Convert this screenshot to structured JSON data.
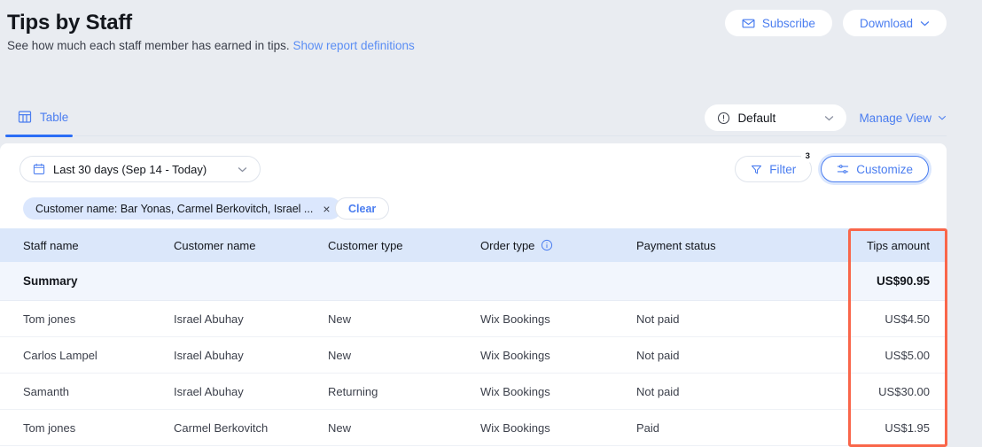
{
  "header": {
    "title": "Tips by Staff",
    "subtitle_text": "See how much each staff member has earned in tips.",
    "subtitle_link": "Show report definitions",
    "subscribe_label": "Subscribe",
    "download_label": "Download"
  },
  "tabs": {
    "items": [
      {
        "label": "Table",
        "icon": "table-icon",
        "active": true
      }
    ],
    "view_select_value": "Default",
    "manage_view_label": "Manage View"
  },
  "filterbar": {
    "date_range": "Last 30 days (Sep 14 - Today)",
    "filter_label": "Filter",
    "filter_count": "3",
    "customize_label": "Customize",
    "chip_label": "Customer name: Bar Yonas, Carmel Berkovitch, Israel ...",
    "chip_close": "×",
    "clear_label": "Clear"
  },
  "table": {
    "columns": [
      "Staff name",
      "Customer name",
      "Customer type",
      "Order type",
      "Payment status",
      "Tips amount"
    ],
    "order_type_has_info_icon": true,
    "summary": {
      "label": "Summary",
      "tips_amount": "US$90.95"
    },
    "rows": [
      {
        "staff_name": "Tom jones",
        "customer_name": "Israel Abuhay",
        "customer_type": "New",
        "order_type": "Wix Bookings",
        "payment_status": "Not paid",
        "tips_amount": "US$4.50"
      },
      {
        "staff_name": "Carlos Lampel",
        "customer_name": "Israel Abuhay",
        "customer_type": "New",
        "order_type": "Wix Bookings",
        "payment_status": "Not paid",
        "tips_amount": "US$5.00"
      },
      {
        "staff_name": "Samanth",
        "customer_name": "Israel Abuhay",
        "customer_type": "Returning",
        "order_type": "Wix Bookings",
        "payment_status": "Not paid",
        "tips_amount": "US$30.00"
      },
      {
        "staff_name": "Tom jones",
        "customer_name": "Carmel Berkovitch",
        "customer_type": "New",
        "order_type": "Wix Bookings",
        "payment_status": "Paid",
        "tips_amount": "US$1.95"
      }
    ]
  },
  "colors": {
    "page_background": "#e9ecf1",
    "accent_blue": "#4a7df0",
    "tab_underline": "#2b6df6",
    "table_header": "#dbe7fa",
    "summary_row": "#f2f6fd",
    "highlight_outline": "#f9664a",
    "chip_background": "#dbe7fd"
  }
}
